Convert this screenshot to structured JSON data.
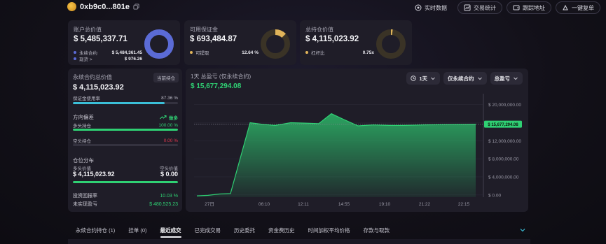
{
  "header": {
    "address": "0xb9c0...801e",
    "actions": [
      "实时数据",
      "交易统计",
      "跟踪地址",
      "一键复单"
    ]
  },
  "cards": {
    "account": {
      "title": "账户总价值",
      "value": "$ 5,485,337.71",
      "rows": [
        {
          "label": "永续合约",
          "value": "$ 5,484,361.45",
          "color": "#5b6bd6"
        },
        {
          "label": "现货 >",
          "value": "$ 976.26",
          "color": "#5b6bd6"
        }
      ],
      "donut_color": "#5b6bd6",
      "donut_fraction": 0.998
    },
    "margin": {
      "title": "可用保证金",
      "value": "$ 693,484.87",
      "rows": [
        {
          "label": "可提取",
          "value": "12.64 %",
          "color": "#e0b45a"
        }
      ],
      "donut_color": "#e0b45a",
      "donut_fraction": 0.1264
    },
    "positions": {
      "title": "总持仓价值",
      "value": "$ 4,115,023.92",
      "rows": [
        {
          "label": "杠杆比",
          "value": "0.75x",
          "color": "#e0b45a"
        }
      ],
      "donut_color": "#e0b45a",
      "donut_fraction": 0.02
    }
  },
  "perp": {
    "title": "永续合约总价值",
    "badge": "当前持仓",
    "value": "$ 4,115,023.92",
    "margin_usage_label": "保证金使用率",
    "margin_usage_value": "87.36 %",
    "margin_usage_fraction": 0.8736,
    "direction_label": "方向偏差",
    "direction_value": "做多",
    "long_label": "多头持仓",
    "long_value": "100.00 %",
    "long_fraction": 1.0,
    "short_label": "空头持仓",
    "short_value": "0.00 %",
    "short_fraction": 0.0,
    "dist_label": "仓位分布",
    "long_val_label": "多头价值",
    "short_val_label": "空头价值",
    "long_val": "$ 4,115,023.92",
    "short_val": "$ 0.00",
    "roi_label": "投资回报率",
    "roi_value": "10.03 %",
    "upnl_label": "未实现盈亏",
    "upnl_value": "$ 480,525.23"
  },
  "chart": {
    "title": "1天 总盈亏 (仅永续合约)",
    "value": "$ 15,677,294.08",
    "controls": [
      "1天",
      "仅永续合约",
      "总盈亏"
    ],
    "current_label": "$ 15,677,294.08"
  },
  "chart_data": {
    "type": "area",
    "title": "1天 总盈亏 (仅永续合约)",
    "x_tick_labels": [
      "27日",
      "06:10",
      "12:11",
      "14:55",
      "19:10",
      "21:22",
      "22:15"
    ],
    "y_tick_labels": [
      "$ 20,000,000.00",
      "$ 16,000,000.00",
      "$ 12,000,000.00",
      "$ 8,000,000.00",
      "$ 4,000,000.00",
      "$ 0.00"
    ],
    "ylim": [
      -500000,
      21500000
    ],
    "series": [
      {
        "values": [
          -200000,
          -100000,
          200000,
          300000,
          16000000,
          15600000,
          15400000,
          16000000,
          15900000,
          15800000,
          18000000,
          16700000,
          15300000,
          15500000,
          15400000,
          15400000,
          15500000,
          15677294
        ]
      }
    ],
    "last_value": 15677294.08,
    "grid": true,
    "color": "#2fd073"
  },
  "tabs": [
    "永续合约持仓 (1)",
    "挂单 (0)",
    "最近成交",
    "已完成交易",
    "历史委托",
    "资金费历史",
    "时间加权平均价格",
    "存款与取款"
  ],
  "active_tab": 2
}
